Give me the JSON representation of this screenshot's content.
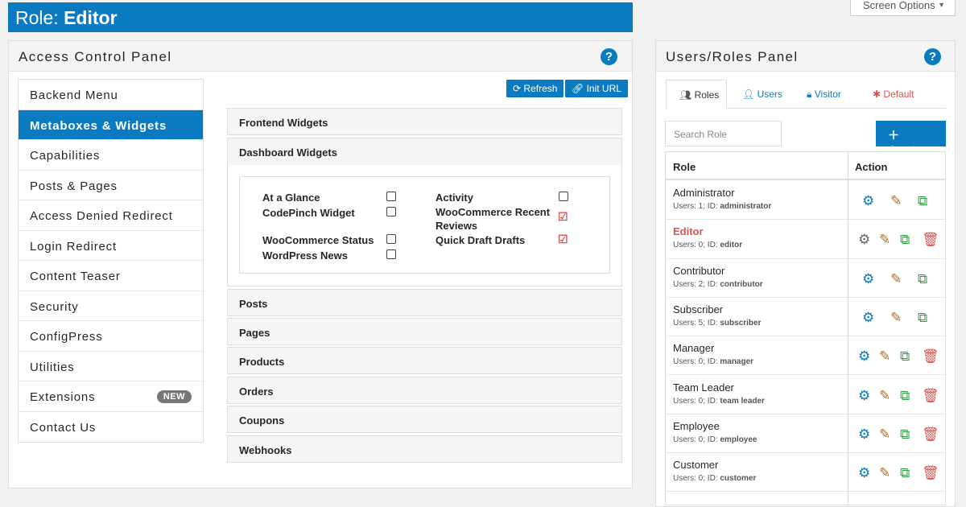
{
  "header": {
    "role_prefix": "Role:",
    "role_name": "Editor",
    "screen_options": "Screen Options"
  },
  "access_panel": {
    "title": "Access Control Panel",
    "help": "?",
    "refresh_label": "Refresh",
    "init_url_label": "Init URL"
  },
  "menu": {
    "items": [
      {
        "label": "Backend Menu"
      },
      {
        "label": "Metaboxes & Widgets"
      },
      {
        "label": "Capabilities"
      },
      {
        "label": "Posts & Pages"
      },
      {
        "label": "Access Denied Redirect"
      },
      {
        "label": "Login Redirect"
      },
      {
        "label": "Content Teaser"
      },
      {
        "label": "Security"
      },
      {
        "label": "ConfigPress"
      },
      {
        "label": "Utilities"
      },
      {
        "label": "Extensions",
        "badge": "NEW"
      },
      {
        "label": "Contact Us"
      }
    ]
  },
  "sections": {
    "frontend": "Frontend Widgets",
    "dashboard": "Dashboard Widgets",
    "posts": "Posts",
    "pages": "Pages",
    "products": "Products",
    "orders": "Orders",
    "coupons": "Coupons",
    "webhooks": "Webhooks"
  },
  "widgets": {
    "at_a_glance": "At a Glance",
    "codepinch": "CodePinch Widget",
    "woo_status": "WooCommerce Status",
    "wp_news": "WordPress News",
    "activity": "Activity",
    "woo_reviews": "WooCommerce Recent Reviews",
    "quick_draft": "Quick Draft Drafts"
  },
  "users_panel": {
    "title": "Users/Roles Panel",
    "help": "?",
    "tabs": [
      {
        "label": "Roles"
      },
      {
        "label": "Users"
      },
      {
        "label": "Visitor"
      },
      {
        "label": "Default"
      }
    ],
    "search_placeholder": "Search Role",
    "create_label": "Create",
    "col_role": "Role",
    "col_action": "Action",
    "roles": [
      {
        "name": "Administrator",
        "meta_a": "Users: 1; ID: ",
        "meta_b": "administrator"
      },
      {
        "name": "Editor",
        "meta_a": "Users: 0; ID: ",
        "meta_b": "editor"
      },
      {
        "name": "Contributor",
        "meta_a": "Users: 2; ID: ",
        "meta_b": "contributor"
      },
      {
        "name": "Subscriber",
        "meta_a": "Users: 5; ID: ",
        "meta_b": "subscriber"
      },
      {
        "name": "Manager",
        "meta_a": "Users: 0; ID: ",
        "meta_b": "manager"
      },
      {
        "name": "Team Leader",
        "meta_a": "Users: 0; ID: ",
        "meta_b": "team leader"
      },
      {
        "name": "Employee",
        "meta_a": "Users: 0; ID: ",
        "meta_b": "employee"
      },
      {
        "name": "Customer",
        "meta_a": "Users: 0; ID: ",
        "meta_b": "customer"
      }
    ]
  },
  "colors": {
    "primary": "#0a7bc0",
    "danger": "#d9534f",
    "success": "#2e9c3e",
    "edit": "#a8702a"
  }
}
